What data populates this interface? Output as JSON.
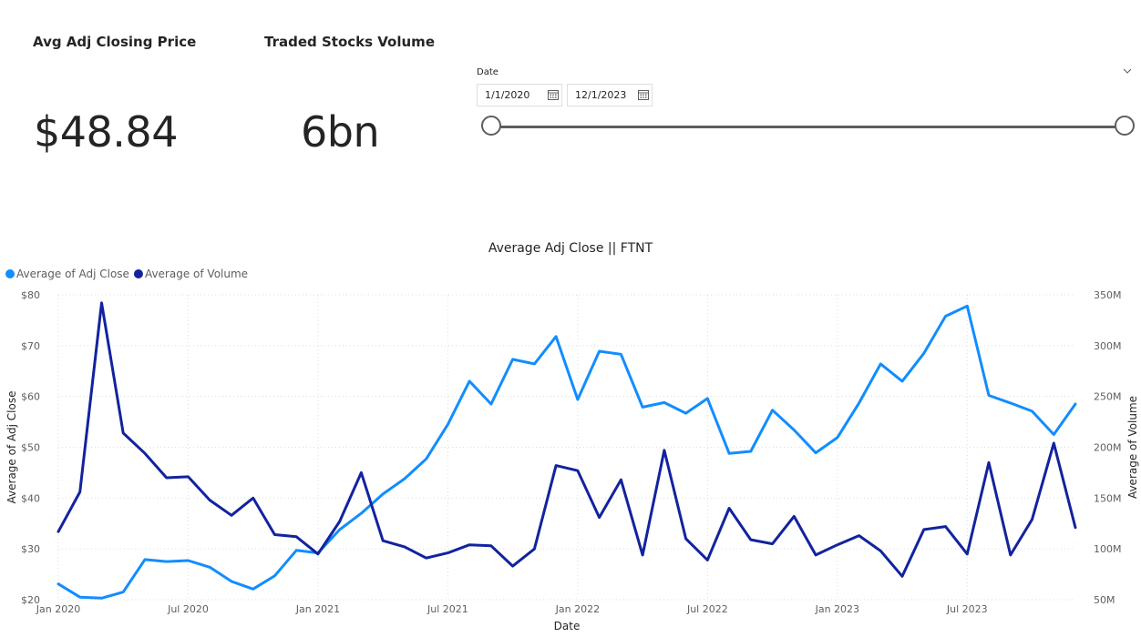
{
  "cards": [
    {
      "title": "Avg Adj Closing Price",
      "value": "$48.84"
    },
    {
      "title": "Traded Stocks Volume",
      "value": "6bn"
    }
  ],
  "slicer": {
    "label": "Date",
    "start": "1/1/2020",
    "end": "12/1/2023",
    "range_start_fraction": 0,
    "range_end_fraction": 1
  },
  "chart_data": {
    "type": "line",
    "title": "Average Adj Close || FTNT",
    "xlabel": "Date",
    "ylabel": "Average of Adj Close",
    "y2label": "Average of Volume",
    "legend_position": "top-left",
    "grid": true,
    "x": [
      "2020-01",
      "2020-02",
      "2020-03",
      "2020-04",
      "2020-05",
      "2020-06",
      "2020-07",
      "2020-08",
      "2020-09",
      "2020-10",
      "2020-11",
      "2020-12",
      "2021-01",
      "2021-02",
      "2021-03",
      "2021-04",
      "2021-05",
      "2021-06",
      "2021-07",
      "2021-08",
      "2021-09",
      "2021-10",
      "2021-11",
      "2021-12",
      "2022-01",
      "2022-02",
      "2022-03",
      "2022-04",
      "2022-05",
      "2022-06",
      "2022-07",
      "2022-08",
      "2022-09",
      "2022-10",
      "2022-11",
      "2022-12",
      "2023-01",
      "2023-02",
      "2023-03",
      "2023-04",
      "2023-05",
      "2023-06",
      "2023-07",
      "2023-08",
      "2023-09",
      "2023-10",
      "2023-11",
      "2023-12"
    ],
    "x_ticks": [
      "Jan 2020",
      "Jul 2020",
      "Jan 2021",
      "Jul 2021",
      "Jan 2022",
      "Jul 2022",
      "Jan 2023",
      "Jul 2023"
    ],
    "y_ticks": [
      "$20",
      "$30",
      "$40",
      "$50",
      "$60",
      "$70",
      "$80"
    ],
    "y2_ticks": [
      "50M",
      "100M",
      "150M",
      "200M",
      "250M",
      "300M",
      "350M"
    ],
    "ylim": [
      20,
      80
    ],
    "y2lim": [
      50000000,
      350000000
    ],
    "series": [
      {
        "name": "Average of Adj Close",
        "axis": "left",
        "color": "#118dff",
        "values": [
          23.1,
          20.5,
          20.3,
          21.5,
          27.9,
          27.5,
          27.7,
          26.4,
          23.6,
          22.1,
          24.7,
          29.7,
          29.2,
          33.8,
          37.0,
          40.8,
          43.8,
          47.7,
          54.5,
          63.0,
          58.5,
          67.3,
          66.4,
          71.8,
          59.4,
          68.9,
          68.3,
          57.9,
          58.8,
          56.7,
          59.6,
          48.8,
          49.2,
          57.3,
          53.4,
          48.9,
          51.9,
          58.7,
          66.4,
          63.0,
          68.5,
          75.8,
          77.8,
          60.2,
          58.7,
          57.1,
          52.5,
          58.5
        ]
      },
      {
        "name": "Average of Volume",
        "axis": "right",
        "color": "#12239e",
        "values": [
          117000000,
          156000000,
          342000000,
          214000000,
          194000000,
          170000000,
          171000000,
          148000000,
          133000000,
          150000000,
          114000000,
          112000000,
          95000000,
          127000000,
          175000000,
          108000000,
          102000000,
          91000000,
          96000000,
          104000000,
          103000000,
          83000000,
          100000000,
          182000000,
          177000000,
          131000000,
          168000000,
          94000000,
          197000000,
          110000000,
          89000000,
          140000000,
          109000000,
          105000000,
          132000000,
          94000000,
          104000000,
          113000000,
          98000000,
          73000000,
          119000000,
          122000000,
          95000000,
          185000000,
          94000000,
          129000000,
          204000000,
          121000000
        ]
      }
    ]
  }
}
